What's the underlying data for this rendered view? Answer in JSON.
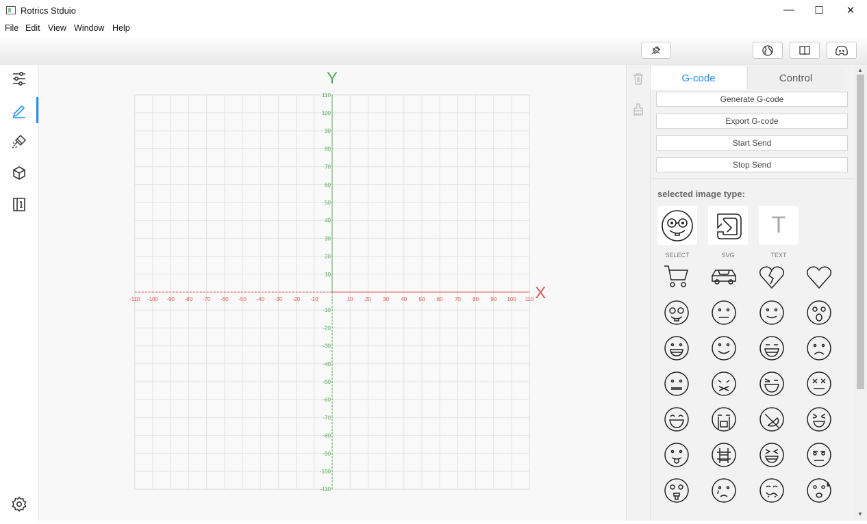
{
  "window": {
    "title": "Rotrics Stduio",
    "minimize_glyph": "—",
    "maximize_glyph": "☐",
    "close_glyph": "✕"
  },
  "menu": [
    "File",
    "Edit",
    "View",
    "Window",
    "Help"
  ],
  "toolbar": {
    "buttons": [
      "disconnect-icon",
      "globe-icon",
      "book-icon",
      "discord-icon"
    ]
  },
  "sidebar": {
    "items": [
      "sliders-icon",
      "pen-icon",
      "laser-icon",
      "cube-icon",
      "book-info-icon"
    ],
    "active": 1,
    "bottom": "gear-icon"
  },
  "canvas": {
    "x_axis_label": "X",
    "y_axis_label": "Y",
    "x_axis_color": "#e55353",
    "y_axis_color": "#4caf50",
    "range": [
      -110,
      110
    ],
    "tick_step": 10,
    "label_step": 10
  },
  "panel": {
    "tabs": [
      "G-code",
      "Control"
    ],
    "active_tab": "G-code",
    "buttons": [
      "Generate G-code",
      "Export G-code",
      "Start Send",
      "Stop Send"
    ],
    "section_title": "selected image type:",
    "image_types": [
      "SELECT",
      "SVG",
      "TEXT"
    ],
    "text_type_glyph": "T",
    "gallery": [
      "cart-icon",
      "car-icon",
      "broken-heart-icon",
      "heart-icon",
      "nerd-face-icon",
      "neutral-face-icon",
      "smile-face-icon",
      "surprised-face-icon",
      "grin-face-icon",
      "happy-face-icon",
      "laugh-face-icon",
      "sad-face-icon",
      "straight-face-icon",
      "zipped-face-icon",
      "wink-laugh-face-icon",
      "dizzy-face-icon",
      "squint-laugh-face-icon",
      "crying-face-icon",
      "tongue-side-face-icon",
      "angry-laugh-face-icon",
      "tongue-out-face-icon",
      "grimace-face-icon",
      "squint-grin-face-icon",
      "unamused-face-icon",
      "tongue-wow-face-icon",
      "tear-face-icon",
      "sick-face-icon",
      "sweat-face-icon"
    ]
  }
}
